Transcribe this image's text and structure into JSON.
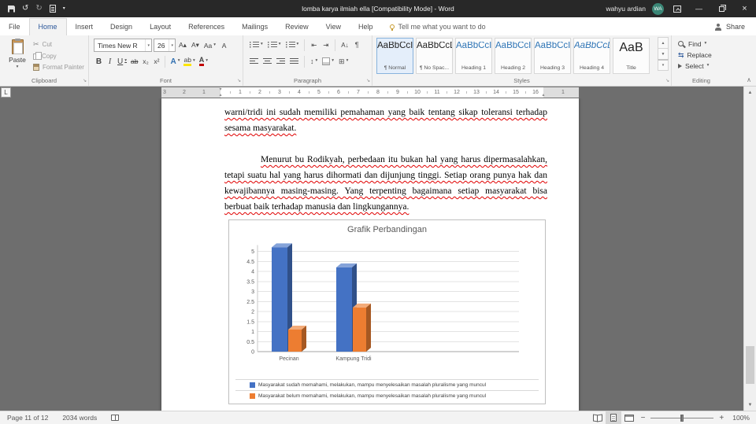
{
  "title_bar": {
    "title": "lomba karya ilmiah ella [Compatibility Mode]  -  Word",
    "user_name": "wahyu ardian",
    "avatar_initials": "WA",
    "avatar_color": "#3a8676"
  },
  "menu": {
    "tabs": [
      "File",
      "Home",
      "Insert",
      "Design",
      "Layout",
      "References",
      "Mailings",
      "Review",
      "View",
      "Help"
    ],
    "active_tab": "Home",
    "tell_me": "Tell me what you want to do",
    "share_label": "Share"
  },
  "ribbon": {
    "clipboard": {
      "group_label": "Clipboard",
      "paste_label": "Paste",
      "cut_label": "Cut",
      "copy_label": "Copy",
      "format_painter_label": "Format Painter"
    },
    "font": {
      "group_label": "Font",
      "font_name": "Times New R",
      "font_size": "26"
    },
    "paragraph": {
      "group_label": "Paragraph"
    },
    "styles": {
      "group_label": "Styles",
      "items": [
        {
          "preview": "AaBbCcI",
          "label": "¶ Normal",
          "kind": "normal",
          "selected": true
        },
        {
          "preview": "AaBbCcDc",
          "label": "¶ No Spac...",
          "kind": "normal"
        },
        {
          "preview": "AaBbCcI",
          "label": "Heading 1",
          "kind": "heading"
        },
        {
          "preview": "AaBbCcI",
          "label": "Heading 2",
          "kind": "heading"
        },
        {
          "preview": "AaBbCcI",
          "label": "Heading 3",
          "kind": "heading"
        },
        {
          "preview": "AaBbCcDc",
          "label": "Heading 4",
          "kind": "heading-italic"
        },
        {
          "preview": "AaB",
          "label": "Title",
          "kind": "title"
        }
      ]
    },
    "editing": {
      "group_label": "Editing",
      "find_label": "Find",
      "replace_label": "Replace",
      "select_label": "Select"
    }
  },
  "icons": {
    "undo": "↺",
    "redo": "↻",
    "dropdown": "▾",
    "minimize": "—",
    "close": "×",
    "cut": "✂",
    "bold": "B",
    "italic": "I",
    "underline": "U",
    "strikethrough": "ab",
    "subscript": "x₂",
    "superscript": "x²",
    "grow_font": "A▴",
    "shrink_font": "A▾",
    "change_case": "Aa",
    "clear_formatting": "A",
    "text_effects": "A",
    "highlight": "ab",
    "font_color": "A",
    "outdent": "⇤",
    "indent": "⇥",
    "sort": "A↓",
    "show_marks": "¶",
    "line_spacing": "↕",
    "borders": "⊞",
    "replace": "⇆",
    "scroll_up": "▲",
    "scroll_down": "▼",
    "gallery_more": "▾",
    "collapse_ribbon": "∧",
    "dialog_launcher": "↘",
    "zoom_out": "−",
    "zoom_in": "+",
    "tab_selector": "L"
  },
  "ruler": {
    "left_numbers": [
      "3",
      "2",
      "1"
    ],
    "center_numbers": [
      "1",
      "2",
      "3",
      "4",
      "5",
      "6",
      "7",
      "8",
      "9",
      "10",
      "11",
      "12",
      "13",
      "14",
      "15",
      "16"
    ],
    "right_numbers": [
      "1"
    ]
  },
  "document": {
    "paragraph1": "warni/tridi ini sudah memiliki pemahaman yang baik tentang sikap toleransi terhadap sesama masyarakat.",
    "paragraph2": "Menurut bu Rodikyah, perbedaan itu bukan hal yang harus dipermasalahkan, tetapi suatu hal yang harus dihormati dan dijunjung tinggi. Setiap orang punya hak dan kewajibannya masing-masing. Yang terpenting bagaimana setiap masyarakat bisa berbuat baik terhadap manusia dan lingkungannya."
  },
  "chart_data": {
    "type": "bar",
    "title": "Grafik Perbandingan",
    "categories": [
      "Pecinan",
      "Kampung Tridi"
    ],
    "series": [
      {
        "name": "Masyarakat sudah memahami, melakukan, mampu menyelesaikan masalah pluralisme yang muncul",
        "color": "#4472C4",
        "values": [
          5.2,
          4.2
        ]
      },
      {
        "name": "Masyarakat belum memahami, melakukan, mampu menyelesaikan masalah pluralisme yang muncul",
        "color": "#ED7D31",
        "values": [
          1.1,
          2.2
        ]
      }
    ],
    "xlabel": "",
    "ylabel": "",
    "ylim": [
      0,
      5
    ],
    "ytick_step": 0.5,
    "grid": true,
    "legend_position": "bottom",
    "effect": "3d"
  },
  "status_bar": {
    "page_label": "Page 11 of 12",
    "word_count": "2034 words",
    "zoom_level": "100%"
  }
}
